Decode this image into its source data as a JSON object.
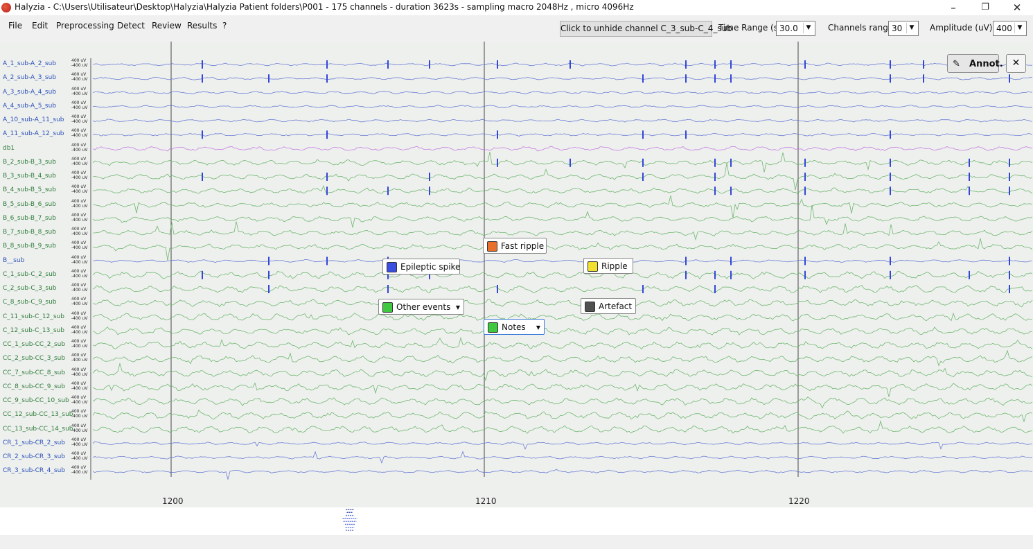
{
  "title": "Halyzia - C:\\Users\\Utilisateur\\Desktop\\Halyzia\\Halyzia Patient folders\\P001 - 175 channels - duration 3623s - sampling macro 2048Hz , micro 4096Hz",
  "window": {
    "minimize": "–",
    "maximize": "❐",
    "close": "✕"
  },
  "menu": [
    "File",
    "Edit",
    "Preprocessing",
    "Detect",
    "Review",
    "Results",
    "?"
  ],
  "toolbar": {
    "unhide_button": "Click to unhide channel C_3_sub-C_4_sub",
    "time_range_label": "Time Range (s):",
    "time_range_value": "30.0",
    "channels_range_label": "Channels range:",
    "channels_range_value": "30",
    "amplitude_label": "Amplitude (uV): ±",
    "amplitude_value": "400"
  },
  "channels": [
    {
      "name": "A_1_sub-A_2_sub",
      "color": "#5b6fd0"
    },
    {
      "name": "A_2_sub-A_3_sub",
      "color": "#5b6fd0"
    },
    {
      "name": "A_3_sub-A_4_sub",
      "color": "#5b6fd0"
    },
    {
      "name": "A_4_sub-A_5_sub",
      "color": "#5b6fd0"
    },
    {
      "name": "A_10_sub-A_11_sub",
      "color": "#5b6fd0"
    },
    {
      "name": "A_11_sub-A_12_sub",
      "color": "#5b6fd0"
    },
    {
      "name": "db1",
      "color": "#c070e0"
    },
    {
      "name": "B_2_sub-B_3_sub",
      "color": "#60b060"
    },
    {
      "name": "B_3_sub-B_4_sub",
      "color": "#60b060"
    },
    {
      "name": "B_4_sub-B_5_sub",
      "color": "#60b060"
    },
    {
      "name": "B_5_sub-B_6_sub",
      "color": "#60b060"
    },
    {
      "name": "B_6_sub-B_7_sub",
      "color": "#60b060"
    },
    {
      "name": "B_7_sub-B_8_sub",
      "color": "#60b060"
    },
    {
      "name": "B_8_sub-B_9_sub",
      "color": "#60b060"
    },
    {
      "name": "B__sub",
      "color": "#5b6fd0"
    },
    {
      "name": "C_1_sub-C_2_sub",
      "color": "#60b060"
    },
    {
      "name": "C_2_sub-C_3_sub",
      "color": "#60b060"
    },
    {
      "name": "C_8_sub-C_9_sub",
      "color": "#60b060"
    },
    {
      "name": "C_11_sub-C_12_sub",
      "color": "#60b060"
    },
    {
      "name": "C_12_sub-C_13_sub",
      "color": "#60b060"
    },
    {
      "name": "CC_1_sub-CC_2_sub",
      "color": "#60b060"
    },
    {
      "name": "CC_2_sub-CC_3_sub",
      "color": "#60b060"
    },
    {
      "name": "CC_7_sub-CC_8_sub",
      "color": "#60b060"
    },
    {
      "name": "CC_8_sub-CC_9_sub",
      "color": "#60b060"
    },
    {
      "name": "CC_9_sub-CC_10_sub",
      "color": "#60b060"
    },
    {
      "name": "CC_12_sub-CC_13_sub",
      "color": "#60b060"
    },
    {
      "name": "CC_13_sub-CC_14_sub",
      "color": "#60b060"
    },
    {
      "name": "CR_1_sub-CR_2_sub",
      "color": "#5b6fd0"
    },
    {
      "name": "CR_2_sub-CR_3_sub",
      "color": "#5b6fd0"
    },
    {
      "name": "CR_3_sub-CR_4_sub",
      "color": "#5b6fd0"
    }
  ],
  "amp_top": "400 uV",
  "amp_bottom": "-400 uV",
  "time_axis": {
    "ticks": [
      "1200",
      "1210",
      "1220"
    ]
  },
  "annotations": {
    "main_button": "Annot.",
    "close": "✕",
    "items": [
      {
        "label": "Fast ripple",
        "color": "#e8702a"
      },
      {
        "label": "Epileptic spike",
        "color": "#3a4ee0"
      },
      {
        "label": "Ripple",
        "color": "#f2e030"
      },
      {
        "label": "Other events",
        "color": "#40c840"
      },
      {
        "label": "Artefact",
        "color": "#505050"
      },
      {
        "label": "Notes",
        "color": "#40c840"
      }
    ]
  },
  "colors": {
    "spike_marker": "#3346d8",
    "cursor": "#444444"
  }
}
